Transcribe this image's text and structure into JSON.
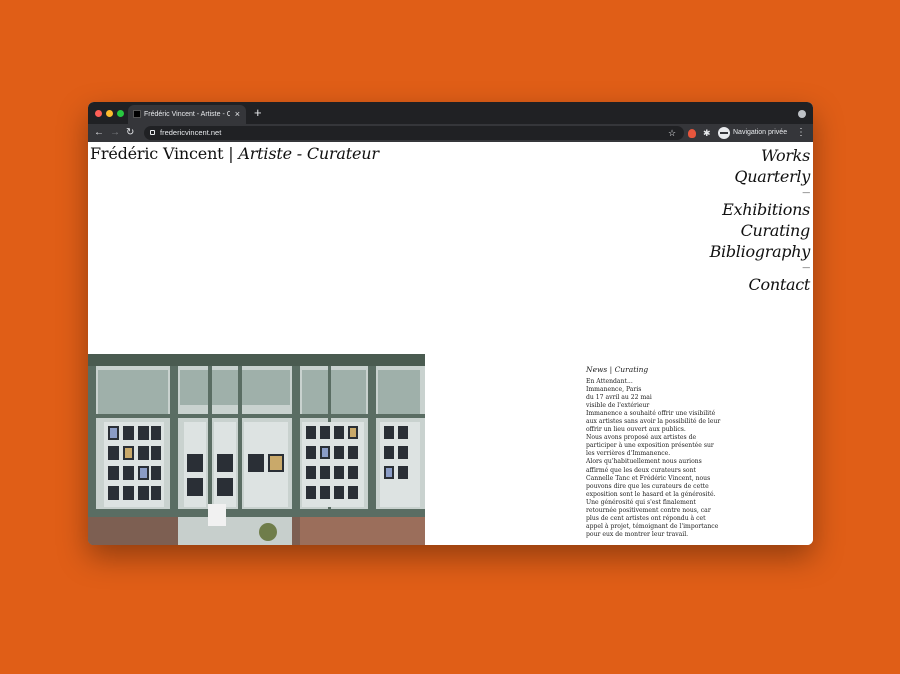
{
  "browser": {
    "tab_title": "Frédéric Vincent - Artiste - Cu",
    "tab_close": "×",
    "new_tab": "+",
    "nav_back": "←",
    "nav_forward": "→",
    "nav_reload": "↻",
    "url": "fredericvincent.net",
    "bookmark": "☆",
    "extensions": "✱",
    "incognito_label": "Navigation privée",
    "menu": "⋮"
  },
  "site": {
    "name": "Frédéric Vincent",
    "separator": " | ",
    "role": "Artiste - Curateur"
  },
  "nav": {
    "works": "Works",
    "quarterly": "Quarterly",
    "dash1": "—",
    "exhibitions": "Exhibitions",
    "curating": "Curating",
    "bibliography": "Bibliography",
    "dash2": "—",
    "contact": "Contact"
  },
  "news": {
    "heading": "News | Curating",
    "body": "En Attendant...\nImmanence, Paris\ndu 17 avril au 22 mai\nvisible de l'extérieur\nImmanence a souhaité offrir une visibilité\naux artistes sans avoir la possibilité de leur\noffrir un lieu ouvert aux publics.\nNous avons proposé aux artistes de\nparticiper à une exposition présentée sur\nles verrières d'Immanence.\nAlors qu'habituellement nous aurions\naffirmé que les deux curateurs sont\nCannelle Tanc et Frédéric Vincent, nous\npouvons dire que les curateurs de cette\nexposition sont le hasard et la générosité.\nUne générosité qui s'est finalement\nretournée positivement contre nous, car\nplus de cent artistes ont répondu à cet\nappel à projet, témoignant de l'importance\npour eux de montrer leur travail."
  },
  "colors": {
    "background": "#e05e17",
    "browser_chrome": "#202124",
    "toolbar": "#35363a"
  }
}
